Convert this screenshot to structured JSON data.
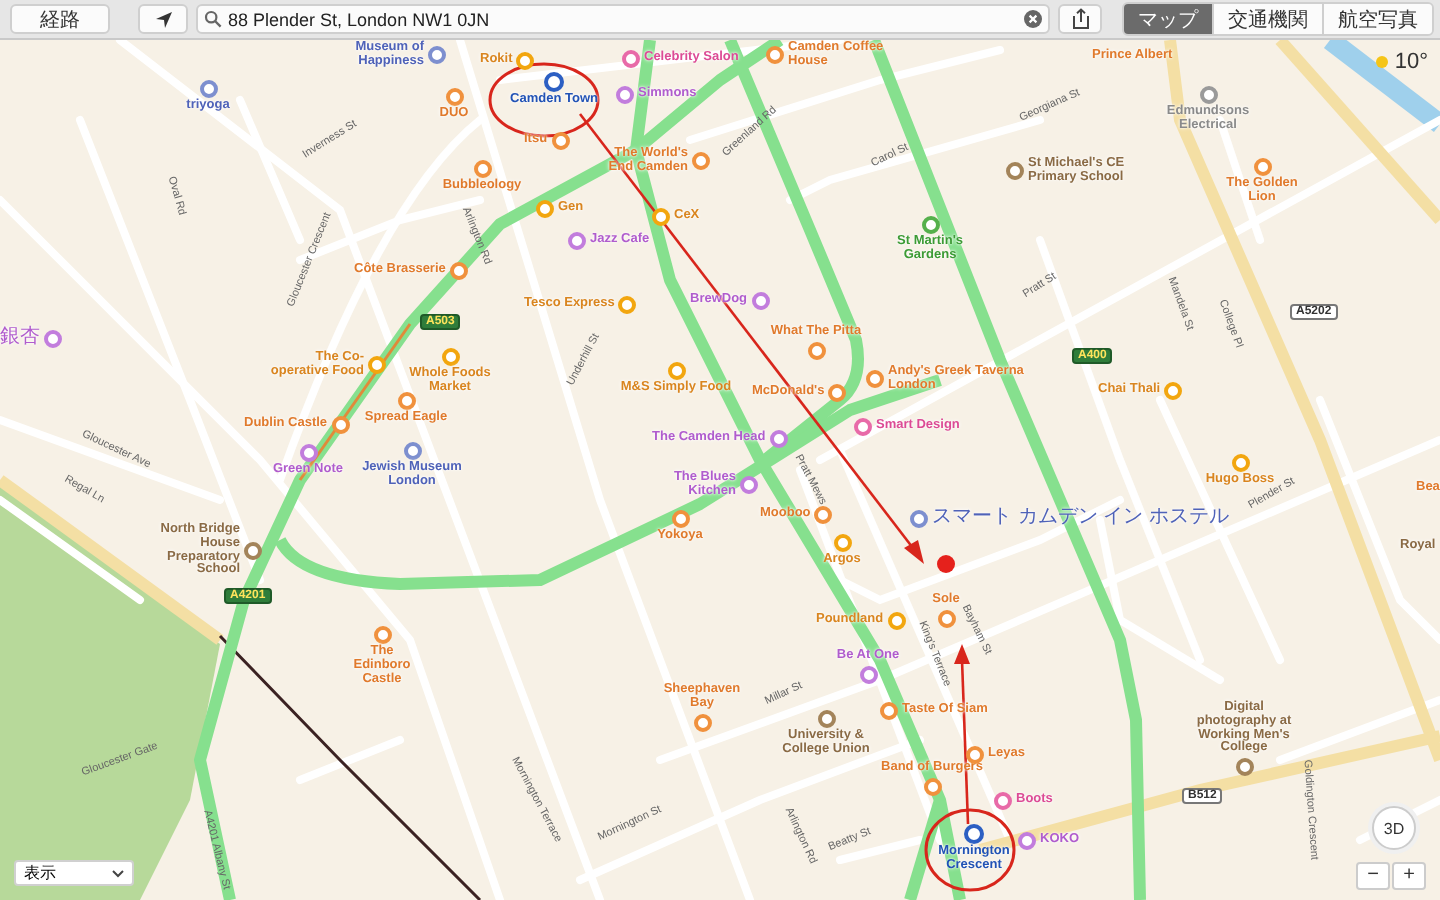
{
  "toolbar": {
    "directions_button": "経路",
    "search": {
      "value": "88 Plender St, London NW1 0JN"
    },
    "view_tabs": [
      {
        "label": "マップ",
        "selected": true
      },
      {
        "label": "交通機関",
        "selected": false
      },
      {
        "label": "航空写真",
        "selected": false
      }
    ]
  },
  "map": {
    "weather": {
      "temperature": "10°"
    },
    "places": [
      {
        "name": "Museum of Happiness",
        "kind": "museum"
      },
      {
        "name": "Rokit",
        "kind": "shop"
      },
      {
        "name": "Celebrity Salon",
        "kind": "beauty"
      },
      {
        "name": "Camden Coffee House",
        "kind": "food"
      },
      {
        "name": "Prince Albert",
        "kind": "food"
      },
      {
        "name": "triyoga",
        "kind": "museum"
      },
      {
        "name": "DUO",
        "kind": "food"
      },
      {
        "name": "Camden Town",
        "kind": "transit"
      },
      {
        "name": "Simmons",
        "kind": "nightlife"
      },
      {
        "name": "Edmundsons Electrical",
        "kind": "generic"
      },
      {
        "name": "Itsu",
        "kind": "food"
      },
      {
        "name": "The World's End Camden",
        "kind": "food"
      },
      {
        "name": "Bubbleology",
        "kind": "food"
      },
      {
        "name": "St Michael's CE Primary School",
        "kind": "school"
      },
      {
        "name": "The Golden Lion",
        "kind": "food"
      },
      {
        "name": "Gen",
        "kind": "shop"
      },
      {
        "name": "CeX",
        "kind": "shop"
      },
      {
        "name": "Jazz Cafe",
        "kind": "nightlife"
      },
      {
        "name": "St Martin's Gardens",
        "kind": "park"
      },
      {
        "name": "Côte Brasserie",
        "kind": "food"
      },
      {
        "name": "Tesco Express",
        "kind": "shop"
      },
      {
        "name": "BrewDog",
        "kind": "nightlife"
      },
      {
        "name": "銀杏",
        "kind": "nightlife"
      },
      {
        "name": "The Co-operative Food",
        "kind": "shop"
      },
      {
        "name": "Whole Foods Market",
        "kind": "shop"
      },
      {
        "name": "M&S Simply Food",
        "kind": "shop"
      },
      {
        "name": "What The Pitta",
        "kind": "food"
      },
      {
        "name": "McDonald's",
        "kind": "food"
      },
      {
        "name": "Andy's Greek Taverna London",
        "kind": "food"
      },
      {
        "name": "Chai Thali",
        "kind": "shop"
      },
      {
        "name": "Dublin Castle",
        "kind": "food"
      },
      {
        "name": "Spread Eagle",
        "kind": "food"
      },
      {
        "name": "The Camden Head",
        "kind": "nightlife"
      },
      {
        "name": "Smart Design",
        "kind": "beauty"
      },
      {
        "name": "Green Note",
        "kind": "nightlife"
      },
      {
        "name": "Jewish Museum London",
        "kind": "museum"
      },
      {
        "name": "The Blues Kitchen",
        "kind": "nightlife"
      },
      {
        "name": "Hugo Boss",
        "kind": "shop"
      },
      {
        "name": "Bea",
        "kind": "food"
      },
      {
        "name": "North Bridge House Preparatory School",
        "kind": "school"
      },
      {
        "name": "Yokoya",
        "kind": "food"
      },
      {
        "name": "Mooboo",
        "kind": "food"
      },
      {
        "name": "Argos",
        "kind": "shop"
      },
      {
        "name": "スマート カムデン イン ホステル",
        "kind": "museum"
      },
      {
        "name": "Royal",
        "kind": "school"
      },
      {
        "name": "Poundland",
        "kind": "shop"
      },
      {
        "name": "Sole",
        "kind": "food"
      },
      {
        "name": "The Edinboro Castle",
        "kind": "food"
      },
      {
        "name": "Be At One",
        "kind": "nightlife"
      },
      {
        "name": "Sheephaven Bay",
        "kind": "food"
      },
      {
        "name": "University & College Union",
        "kind": "school"
      },
      {
        "name": "Taste Of Siam",
        "kind": "food"
      },
      {
        "name": "Digital photography at Working Men's College",
        "kind": "school"
      },
      {
        "name": "Band of Burgers",
        "kind": "food"
      },
      {
        "name": "Leyas",
        "kind": "food"
      },
      {
        "name": "Boots",
        "kind": "beauty"
      },
      {
        "name": "Mornington Crescent",
        "kind": "transit"
      },
      {
        "name": "KOKO",
        "kind": "nightlife"
      }
    ],
    "streets": [
      {
        "name": "Inverness St"
      },
      {
        "name": "Oval Rd"
      },
      {
        "name": "Gloucester Crescent"
      },
      {
        "name": "Arlington Rd"
      },
      {
        "name": "Underhill St"
      },
      {
        "name": "Gloucester Ave"
      },
      {
        "name": "Regal Ln"
      },
      {
        "name": "Gloucester Gate"
      },
      {
        "name": "Mornington Terrace"
      },
      {
        "name": "Mornington St"
      },
      {
        "name": "Millar St"
      },
      {
        "name": "Arlington Rd"
      },
      {
        "name": "Beatty St"
      },
      {
        "name": "Pratt Mews"
      },
      {
        "name": "Bayham St"
      },
      {
        "name": "King's Terrace"
      },
      {
        "name": "Pratt St"
      },
      {
        "name": "Plender St"
      },
      {
        "name": "Georgiana St"
      },
      {
        "name": "Carol St"
      },
      {
        "name": "Greenland Rd"
      },
      {
        "name": "Mandela St"
      },
      {
        "name": "College Pl"
      },
      {
        "name": "Goldington Crescent"
      },
      {
        "name": "A4201  Albany St"
      }
    ],
    "road_shields": [
      {
        "label": "A503"
      },
      {
        "label": "A400"
      },
      {
        "label": "A5202"
      },
      {
        "label": "A4201"
      },
      {
        "label": "B512"
      }
    ],
    "view_menu": {
      "label": "表示"
    },
    "compass_button": "3D",
    "zoom_out": "−",
    "zoom_in": "+"
  }
}
